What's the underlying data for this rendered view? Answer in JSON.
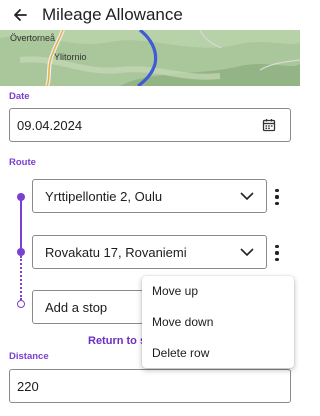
{
  "header": {
    "title": "Mileage Allowance",
    "back_icon": "arrow-left-icon"
  },
  "map": {
    "labels": [
      {
        "name": "Övertorneå"
      },
      {
        "name": "Ylitornio"
      }
    ]
  },
  "date": {
    "label": "Date",
    "value": "09.04.2024",
    "icon": "calendar-icon"
  },
  "route": {
    "label": "Route",
    "stops": [
      {
        "value": "Yrttipellontie 2, Oulu"
      },
      {
        "value": "Rovakatu 17, Rovaniemi"
      }
    ],
    "add_stop_placeholder": "Add a stop",
    "return_link": "Return to s"
  },
  "context_menu": {
    "items": [
      {
        "label": "Move up"
      },
      {
        "label": "Move down"
      },
      {
        "label": "Delete row"
      }
    ]
  },
  "distance": {
    "label": "Distance",
    "value": "220"
  },
  "colors": {
    "accent": "#7b3fd1",
    "map_road": "#3f5bd6"
  }
}
